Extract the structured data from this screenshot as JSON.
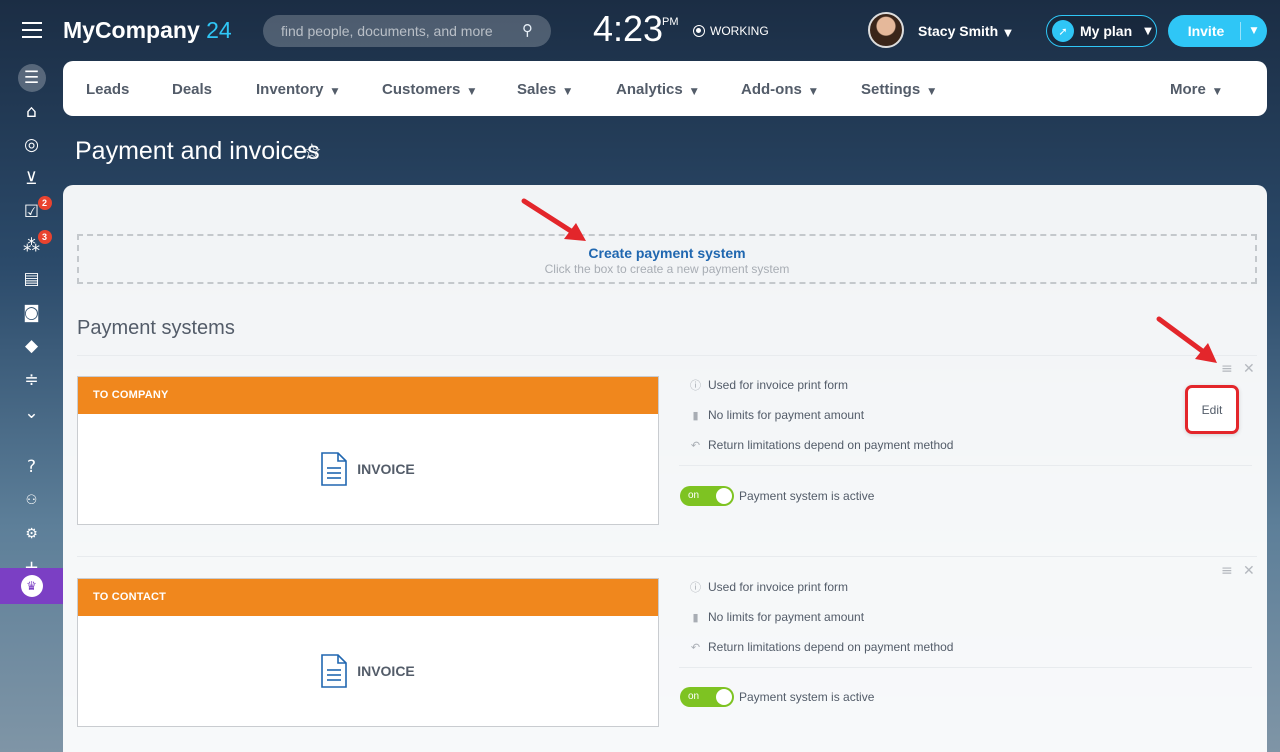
{
  "header": {
    "logo_name": "MyCompany",
    "logo_num": "24",
    "search_placeholder": "find people, documents, and more",
    "time": "4:23",
    "ampm": "PM",
    "status": "WORKING",
    "user": "Stacy Smith",
    "plan_label": "My plan",
    "invite_label": "Invite"
  },
  "sidebar": {
    "icons": [
      "filter-icon",
      "bank-icon",
      "target-icon",
      "cart-icon",
      "tasks-icon",
      "network-icon",
      "contact-card-icon",
      "robot-icon",
      "box-icon",
      "sliders-icon",
      "more-down-icon"
    ],
    "tasks_badge": "2",
    "network_badge": "3",
    "bottom_icons": [
      "help-icon",
      "sitemap-icon",
      "settings-icon",
      "plus-icon",
      "crown-icon"
    ]
  },
  "menu": {
    "items": [
      {
        "label": "Leads",
        "dropdown": false
      },
      {
        "label": "Deals",
        "dropdown": false
      },
      {
        "label": "Inventory",
        "dropdown": true
      },
      {
        "label": "Customers",
        "dropdown": true
      },
      {
        "label": "Sales",
        "dropdown": true
      },
      {
        "label": "Analytics",
        "dropdown": true
      },
      {
        "label": "Add-ons",
        "dropdown": true
      },
      {
        "label": "Settings",
        "dropdown": true
      },
      {
        "label": "More",
        "dropdown": true
      }
    ]
  },
  "page": {
    "title": "Payment and invoices",
    "create_title": "Create payment system",
    "create_subtitle": "Click the box to create a new payment system",
    "section_title": "Payment systems"
  },
  "payment_systems": [
    {
      "header": "TO COMPANY",
      "card_label": "INVOICE",
      "info": [
        "Used for invoice print form",
        "No limits for payment amount",
        "Return limitations depend on payment method"
      ],
      "toggle_label": "on",
      "active_text": "Payment system is active"
    },
    {
      "header": "TO CONTACT",
      "card_label": "INVOICE",
      "info": [
        "Used for invoice print form",
        "No limits for payment amount",
        "Return limitations depend on payment method"
      ],
      "toggle_label": "on",
      "active_text": "Payment system is active"
    }
  ],
  "edit_label": "Edit",
  "colors": {
    "accent": "#2fc6f6",
    "card_header": "#f0871d",
    "toggle_on": "#7ec322",
    "highlight": "#e3262b",
    "link": "#2067b0"
  }
}
